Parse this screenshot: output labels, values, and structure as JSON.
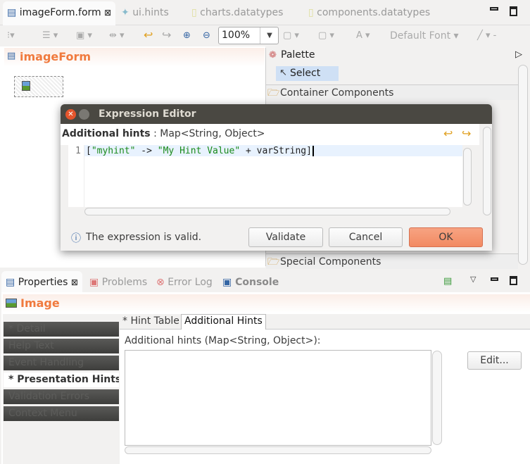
{
  "editor_tabs": [
    {
      "label": "imageForm.form",
      "active": true
    },
    {
      "label": "ui.hints"
    },
    {
      "label": "charts.datatypes"
    },
    {
      "label": "components.datatypes"
    }
  ],
  "toolbar": {
    "zoom": "100%",
    "font_label": "A",
    "font": "Default Font"
  },
  "form": {
    "title": "imageForm"
  },
  "palette": {
    "title": "Palette",
    "select": "Select",
    "drawers": [
      "Container Components",
      "Special Components"
    ]
  },
  "dialog": {
    "title": "Expression Editor",
    "header_bold": "Additional hints",
    "header_type": " : Map<String, Object>",
    "line_number": "1",
    "code": {
      "open": "[",
      "key": "\"myhint\"",
      "arrow": " -> ",
      "value": "\"My Hint Value\"",
      "rest": " + varString]"
    },
    "status": "The expression is valid.",
    "validate": "Validate",
    "cancel": "Cancel",
    "ok": "OK"
  },
  "bottom_tabs": [
    {
      "label": "Properties",
      "active": true
    },
    {
      "label": "Problems"
    },
    {
      "label": "Error Log"
    },
    {
      "label": "Console"
    }
  ],
  "properties": {
    "title": "Image",
    "sections": [
      "* Detail",
      "Help Text",
      "Event Handling",
      "* Presentation Hints",
      "Validation Errors",
      "Context Menu"
    ],
    "subtabs": [
      "* Hint Table",
      "Additional Hints"
    ],
    "field_label": "Additional hints (Map<String, Object>):",
    "edit": "Edit...",
    "field_value": ""
  },
  "colors": {
    "accent": "#f07a3e",
    "ok_button": "#f5906a",
    "title_bar": "#4a4842",
    "string": "#1a8a1a"
  }
}
